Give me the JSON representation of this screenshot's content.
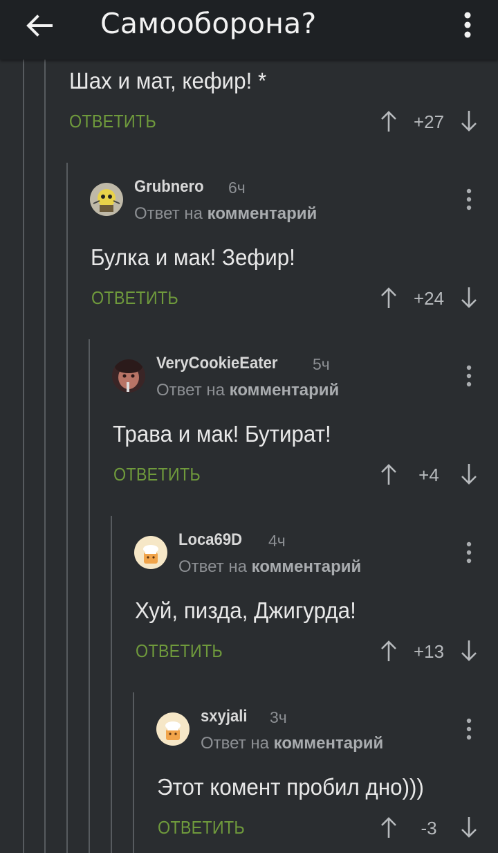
{
  "header": {
    "title": "Самооборона?"
  },
  "reply_to_label": "Ответ на",
  "reply_to_link": "комментарий",
  "reply_button_label": "ОТВЕТИТЬ",
  "colors": {
    "background": "#2a2d30",
    "topbar": "#1e2124",
    "reply_button": "#6f9a3c",
    "text": "#e4e4e4",
    "muted": "#8d9094"
  },
  "comments": [
    {
      "text": "Шах и мат, кефир! *",
      "rating": "+27"
    },
    {
      "username": "Grubnero",
      "time": "6ч",
      "text": "Булка и мак! Зефир!",
      "rating": "+24",
      "avatar_icon": "cartoon-avatar-icon"
    },
    {
      "username": "VeryCookieEater",
      "time": "5ч",
      "text": "Трава и мак! Бутират!",
      "rating": "+4",
      "avatar_icon": "photo-avatar-icon"
    },
    {
      "username": "Loca69D",
      "time": "4ч",
      "text": "Хуй, пизда, Джигурда!",
      "rating": "+13",
      "avatar_icon": "default-chef-avatar-icon"
    },
    {
      "username": "sxyjali",
      "time": "3ч",
      "text": "Этот комент пробил дно)))",
      "rating": "-3",
      "avatar_icon": "default-chef-avatar-icon"
    }
  ]
}
